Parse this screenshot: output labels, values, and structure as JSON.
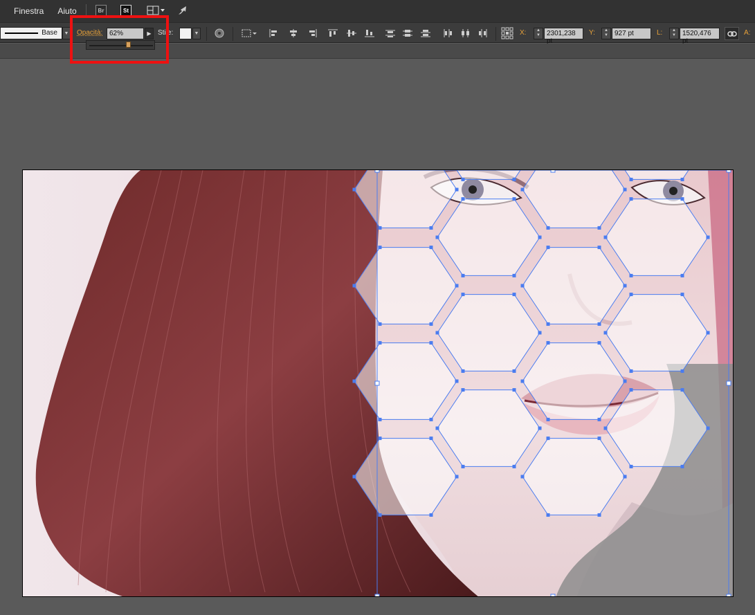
{
  "menu": {
    "items": [
      "Finestra",
      "Aiuto"
    ],
    "bridge_icon": "Br",
    "stock_icon": "St"
  },
  "controlbar": {
    "stroke_profile": "Base",
    "opacity_label": "Opacità:",
    "opacity_value": "62%",
    "style_label": "Stile:",
    "x_label": "X:",
    "x_value": "2301,238 pt",
    "y_label": "Y:",
    "y_value": "927 pt",
    "w_label": "L:",
    "w_value": "1520,476 pt",
    "h_label": "A:"
  },
  "slider": {
    "opacity_fraction": 0.62
  },
  "colors": {
    "highlight": "#ee1111",
    "label_orange": "#e8a23a",
    "selection_blue": "#4a7cf0"
  },
  "icons": [
    "bridge-icon",
    "stock-icon",
    "workspace-icon",
    "rocket-icon",
    "recolor-icon",
    "transform-icon",
    "align-left-icon",
    "align-hcenter-icon",
    "align-right-icon",
    "align-top-icon",
    "align-vcenter-icon",
    "align-bottom-icon",
    "distribute-top-icon",
    "distribute-vcenter-icon",
    "distribute-bottom-icon",
    "distribute-left-icon",
    "distribute-hcenter-icon",
    "distribute-right-icon",
    "reference-point-icon",
    "link-icon"
  ]
}
